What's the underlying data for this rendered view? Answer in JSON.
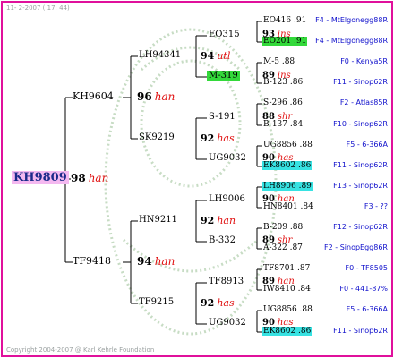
{
  "header": {
    "date_text": "11-  2-2007 ( 17: 44)"
  },
  "footer": {
    "copyright": "Copyright 2004-2007 @ Karl Kehrle Foundation"
  },
  "pedigree": {
    "root": {
      "name": "KH9809",
      "score": "98",
      "sym": "han"
    },
    "gen1": [
      {
        "name": "KH9604",
        "score": "96",
        "sym": "han"
      },
      {
        "name": "TF9418",
        "score": "94",
        "sym": "han"
      }
    ],
    "gen2": [
      {
        "name": "LH94341",
        "score": "94",
        "sym": "utl"
      },
      {
        "name": "SK9219",
        "score": "92",
        "sym": "has"
      },
      {
        "name": "HN9211",
        "score": "92",
        "sym": "han"
      },
      {
        "name": "TF9215",
        "score": "92",
        "sym": "has"
      }
    ],
    "gen3": [
      {
        "name": "EO315",
        "score": "93",
        "sym": "ins"
      },
      {
        "name": "M-319",
        "score": "89",
        "sym": "ins",
        "highlight": "green"
      },
      {
        "name": "S-191",
        "score": "88",
        "sym": "shr"
      },
      {
        "name": "UG9032",
        "score": "90",
        "sym": "has"
      },
      {
        "name": "LH9006",
        "score": "90",
        "sym": "han"
      },
      {
        "name": "B-332",
        "score": "89",
        "sym": "shr"
      },
      {
        "name": "TF8913",
        "score": "89",
        "sym": "han"
      },
      {
        "name": "UG9032",
        "score": "90",
        "sym": "has"
      }
    ],
    "gen4": [
      {
        "name": "EO416 .91",
        "desc": "F4 - MtElgonegg88R"
      },
      {
        "name": "EO201 .91",
        "desc": "F4 - MtElgonegg88R",
        "highlight": "green"
      },
      {
        "name": "M-5 .88",
        "desc": "F0 - Kenya5R"
      },
      {
        "name": "B-123 .86",
        "desc": "F11 - Sinop62R"
      },
      {
        "name": "S-296 .86",
        "desc": "F2 - Atlas85R"
      },
      {
        "name": "B-137 .84",
        "desc": "F10 - Sinop62R"
      },
      {
        "name": "UG8856 .88",
        "desc": "F5 - 6-366A"
      },
      {
        "name": "EK8602 .86",
        "desc": "F11 - Sinop62R",
        "highlight": "cyan"
      },
      {
        "name": "LH8906 .89",
        "desc": "F13 - Sinop62R",
        "highlight": "cyan"
      },
      {
        "name": "HN8401 .84",
        "desc": "F3 - ??"
      },
      {
        "name": "B-209 .88",
        "desc": "F12 - Sinop62R"
      },
      {
        "name": "A-322 .87",
        "desc": "F2 - SinopEgg86R"
      },
      {
        "name": "TF8701 .87",
        "desc": "F0 - TF8505"
      },
      {
        "name": "IW8410 .84",
        "desc": "F0 - 441-87%"
      },
      {
        "name": "UG8856 .88",
        "desc": "F5 - 6-366A"
      },
      {
        "name": "EK8602 .86",
        "desc": "F11 - Sinop62R",
        "highlight": "cyan"
      }
    ]
  },
  "colors": {
    "frame": "#e0109c",
    "root_bg": "#f4b8f0",
    "green": "#33d93a",
    "cyan": "#37e2e2",
    "desc": "#1010cc",
    "symbol": "#e01010"
  }
}
